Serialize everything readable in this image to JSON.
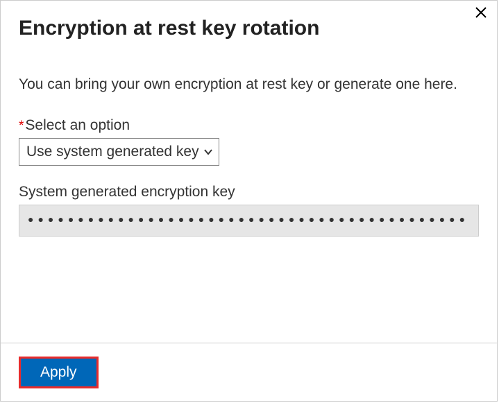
{
  "dialog": {
    "title": "Encryption at rest key rotation",
    "description": "You can bring your own encryption at rest key or generate one here.",
    "option_field": {
      "label": "Select an option",
      "selected": "Use system generated key"
    },
    "key_field": {
      "label": "System generated encryption key",
      "masked": "●●●●●●●●●●●●●●●●●●●●●●●●●●●●●●●●●●●●●●●●●●●●"
    },
    "apply_label": "Apply"
  }
}
